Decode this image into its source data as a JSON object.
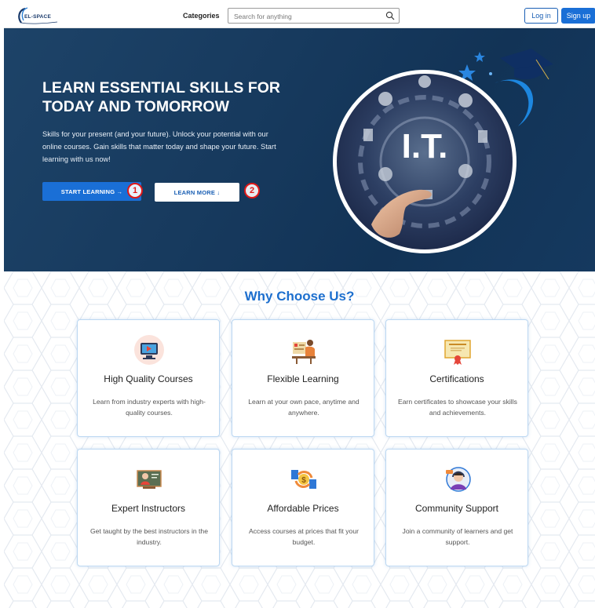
{
  "nav": {
    "logo_text": "EL-SPACE",
    "categories": "Categories",
    "search_placeholder": "Search for anything",
    "login": "Log in",
    "signup": "Sign up"
  },
  "hero": {
    "title": "LEARN ESSENTIAL SKILLS FOR TODAY AND TOMORROW",
    "description": "Skills for your present (and your future). Unlock your potential with our online courses. Gain skills that matter today and shape your future. Start learning with us now!",
    "start_button": "START LEARNING →",
    "more_button": "LEARN MORE ↓",
    "marker_1": "1",
    "marker_2": "2",
    "illustration_text": "I.T."
  },
  "why": {
    "title": "Why Choose Us?",
    "cards": [
      {
        "title": "High Quality Courses",
        "text": "Learn from industry experts with high-quality courses.",
        "icon": "video-lesson-icon"
      },
      {
        "title": "Flexible Learning",
        "text": "Learn at your own pace, anytime and anywhere.",
        "icon": "study-desk-icon"
      },
      {
        "title": "Certifications",
        "text": "Earn certificates to showcase your skills and achievements.",
        "icon": "certificate-icon"
      },
      {
        "title": "Expert Instructors",
        "text": "Get taught by the best instructors in the industry.",
        "icon": "instructor-icon"
      },
      {
        "title": "Affordable Prices",
        "text": "Access courses at prices that fit your budget.",
        "icon": "price-exchange-icon"
      },
      {
        "title": "Community Support",
        "text": "Join a community of learners and get support.",
        "icon": "support-agent-icon"
      }
    ]
  },
  "colors": {
    "primary": "#1a6fd6",
    "hero_bg": "#173a5e",
    "heading_blue": "#1d6fce",
    "marker_red": "#e01818"
  }
}
